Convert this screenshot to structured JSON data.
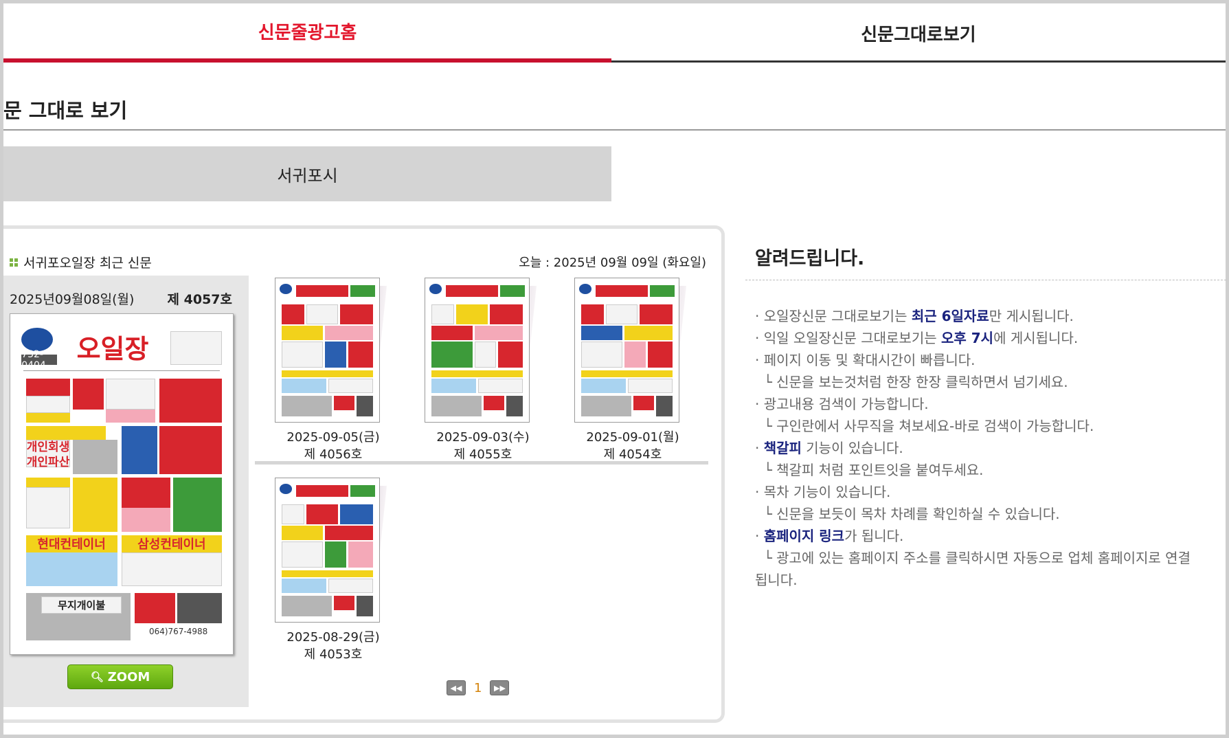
{
  "tabs": {
    "active": "신문줄광고홈",
    "other": "신문그대로보기"
  },
  "page_heading": "문 그대로 보기",
  "region": "서귀포시",
  "panel": {
    "title": "서귀포오일장 최근 신문",
    "today": "오늘 : 2025년 09월 09일 (화요일)",
    "latest": {
      "date": "2025년09월08일(월)",
      "issue": "제 4057호",
      "zoom_label": "ZOOM"
    },
    "issues": [
      {
        "date": "2025-09-05(금)",
        "no": "제 4056호"
      },
      {
        "date": "2025-09-03(수)",
        "no": "제 4055호"
      },
      {
        "date": "2025-09-01(월)",
        "no": "제 4054호"
      },
      {
        "date": "2025-08-29(금)",
        "no": "제 4053호"
      }
    ],
    "pager": {
      "prev": "◀◀",
      "current": "1",
      "next": "▶▶"
    }
  },
  "cover": {
    "logo": "오일장",
    "phone": "732-0404",
    "headline1": "개인회생",
    "headline2": "개인파산",
    "banner1": "현대컨테이너",
    "banner2": "삼성컨테이너",
    "bottom": "무지개이불",
    "bottom_phone": "064)767-4988"
  },
  "notice": {
    "title": "알려드립니다.",
    "lines": [
      {
        "pre": "· 오일장신문 그대로보기는 ",
        "hl": "최근 6일자료",
        "post": "만 게시됩니다."
      },
      {
        "pre": "· 익일 오일장신문 그대로보기는 ",
        "hl": "오후 7시",
        "post": "에 게시됩니다."
      },
      {
        "pre": "· 페이지 이동 및 확대시간이 빠릅니다.",
        "hl": "",
        "post": ""
      },
      {
        "pre": "  └ 신문을 보는것처럼 한장 한장 클릭하면서 넘기세요.",
        "hl": "",
        "post": ""
      },
      {
        "pre": "· 광고내용 검색이 가능합니다.",
        "hl": "",
        "post": ""
      },
      {
        "pre": "  └ 구인란에서 사무직을 쳐보세요-바로 검색이 가능합니다.",
        "hl": "",
        "post": ""
      },
      {
        "pre": "· ",
        "hl": "책갈피",
        "post": " 기능이 있습니다."
      },
      {
        "pre": "  └ 책갈피 처럼 포인트잇을 붙여두세요.",
        "hl": "",
        "post": ""
      },
      {
        "pre": "· 목차 기능이 있습니다.",
        "hl": "",
        "post": ""
      },
      {
        "pre": "  └ 신문을 보듯이 목차 차례를 확인하실 수 있습니다.",
        "hl": "",
        "post": ""
      },
      {
        "pre": "· ",
        "hl": "홈페이지 링크",
        "post": "가 됩니다."
      },
      {
        "pre": "  └ 광고에 있는 홈페이지 주소를 클릭하시면 자동으로 업체 홈페이지로 연결",
        "hl": "",
        "post": ""
      },
      {
        "pre": "됩니다.",
        "hl": "",
        "post": ""
      }
    ]
  }
}
